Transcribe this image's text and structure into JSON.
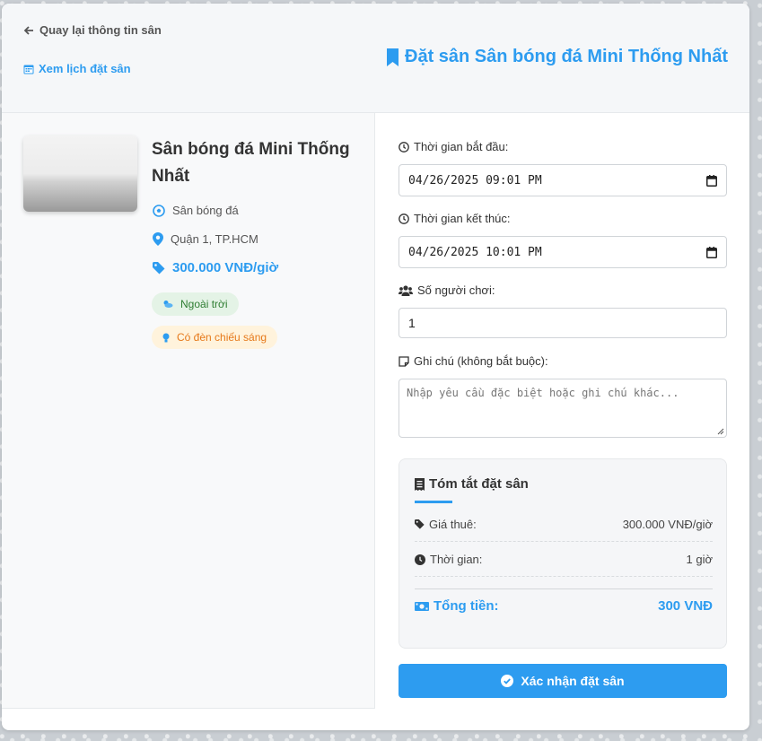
{
  "header": {
    "back_label": "Quay lại thông tin sân",
    "schedule_label": "Xem lịch đặt sân",
    "title": "Đặt sân Sân bóng đá Mini Thống Nhất"
  },
  "venue": {
    "name": "Sân bóng đá Mini Thống Nhất",
    "type": "Sân bóng đá",
    "location": "Quận 1, TP.HCM",
    "price": "300.000 VNĐ/giờ",
    "tags": [
      "Ngoài trời",
      "Có đèn chiếu sáng"
    ]
  },
  "form": {
    "start_label": "Thời gian bắt đầu:",
    "start_value": "04/26/2025 09:01 PM",
    "end_label": "Thời gian kết thúc:",
    "end_value": "04/26/2025 10:01 PM",
    "players_label": "Số người chơi:",
    "players_value": "1",
    "note_label": "Ghi chú (không bắt buộc):",
    "note_placeholder": "Nhập yêu cầu đặc biệt hoặc ghi chú khác..."
  },
  "summary": {
    "title": "Tóm tắt đặt sân",
    "price_label": "Giá thuê:",
    "price_value": "300.000 VNĐ/giờ",
    "time_label": "Thời gian:",
    "time_value": "1 giờ",
    "total_label": "Tổng tiền:",
    "total_value": "300 VNĐ"
  },
  "confirm_label": "Xác nhận đặt sân",
  "colors": {
    "accent": "#2d9cf0",
    "green_tag_bg": "#e4f3e6",
    "orange_tag_bg": "#fff3dc"
  }
}
